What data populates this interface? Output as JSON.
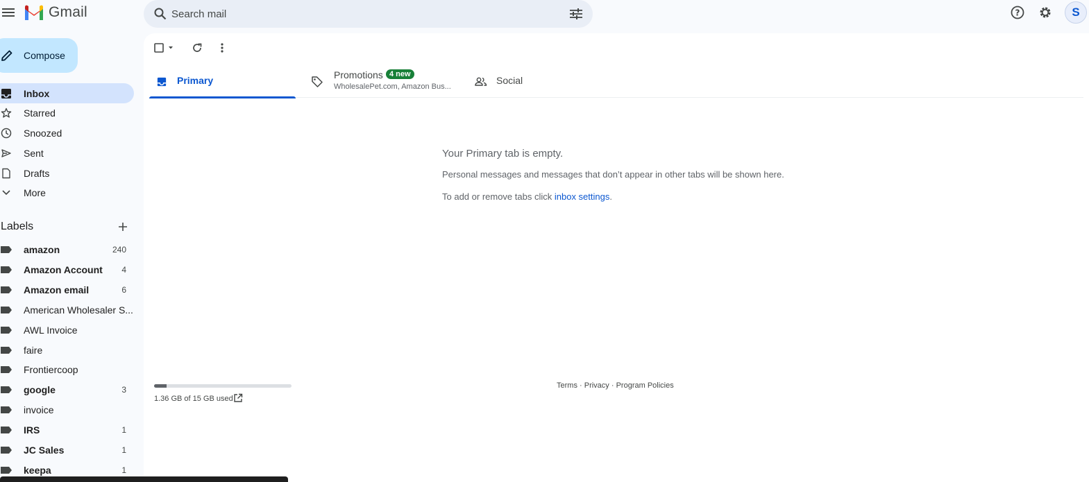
{
  "header": {
    "app_name": "Gmail",
    "search_placeholder": "Search mail",
    "avatar_initial": "S"
  },
  "sidebar": {
    "compose_label": "Compose",
    "nav": [
      {
        "label": "Inbox",
        "icon": "inbox-icon",
        "active": true
      },
      {
        "label": "Starred",
        "icon": "star-icon"
      },
      {
        "label": "Snoozed",
        "icon": "clock-icon"
      },
      {
        "label": "Sent",
        "icon": "send-icon"
      },
      {
        "label": "Drafts",
        "icon": "draft-icon"
      },
      {
        "label": "More",
        "icon": "chevron-down-icon"
      }
    ],
    "labels_title": "Labels",
    "labels": [
      {
        "name": "amazon",
        "count": "240",
        "bold": true
      },
      {
        "name": "Amazon Account",
        "count": "4",
        "bold": true
      },
      {
        "name": "Amazon email",
        "count": "6",
        "bold": true
      },
      {
        "name": "American Wholesaler S...",
        "count": "",
        "bold": false
      },
      {
        "name": "AWL Invoice",
        "count": "",
        "bold": false
      },
      {
        "name": "faire",
        "count": "",
        "bold": false
      },
      {
        "name": "Frontiercoop",
        "count": "",
        "bold": false
      },
      {
        "name": "google",
        "count": "3",
        "bold": true
      },
      {
        "name": "invoice",
        "count": "",
        "bold": false
      },
      {
        "name": "IRS",
        "count": "1",
        "bold": true
      },
      {
        "name": "JC Sales",
        "count": "1",
        "bold": true
      },
      {
        "name": "keepa",
        "count": "1",
        "bold": true
      }
    ]
  },
  "tabs": {
    "primary": "Primary",
    "promotions": "Promotions",
    "promotions_badge": "4 new",
    "promotions_senders": "WholesalePet.com, Amazon Bus...",
    "social": "Social"
  },
  "empty_state": {
    "heading": "Your Primary tab is empty.",
    "line1": "Personal messages and messages that don’t appear in other tabs will be shown here.",
    "line2_prefix": "To add or remove tabs click ",
    "line2_link": "inbox settings",
    "line2_suffix": "."
  },
  "storage": {
    "used_text": "1.36 GB of 15 GB used",
    "used_fraction": 0.09
  },
  "footer": {
    "terms": "Terms",
    "privacy": "Privacy",
    "policies": "Program Policies",
    "sep": " · "
  },
  "colors": {
    "accent": "#0b57d0",
    "compose_bg": "#c2e7ff",
    "active_nav_bg": "#d3e3fd",
    "badge_green": "#188038"
  }
}
